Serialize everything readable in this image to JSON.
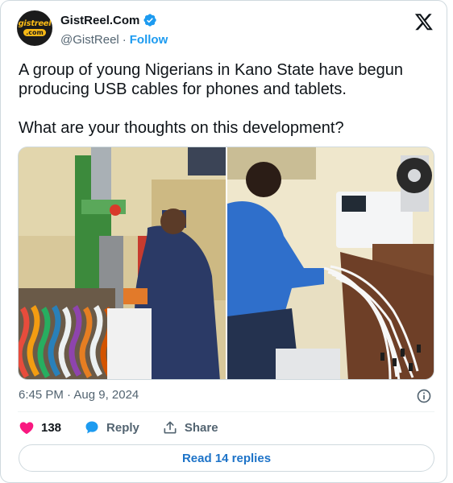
{
  "author": {
    "display_name": "GistReel.Com",
    "handle": "@GistReel",
    "separator": "·",
    "follow_label": "Follow",
    "avatar_text_top": "gistreel",
    "avatar_text_bottom": ".com",
    "verified": true
  },
  "tweet": {
    "text": "A group of young Nigerians in Kano State have begun producing USB cables for phones and tablets.\n\nWhat are your thoughts on this development?",
    "timestamp": "6:45 PM · Aug 9, 2024"
  },
  "media": {
    "photos": [
      {
        "name": "left-photo",
        "subject": "worker at injection molding machine with spools of wire"
      },
      {
        "name": "right-photo",
        "subject": "worker assembling USB cables at table with coiling machine"
      }
    ]
  },
  "actions": {
    "like_count": "138",
    "reply_label": "Reply",
    "share_label": "Share"
  },
  "read_replies_label": "Read 14 replies",
  "colors": {
    "accent": "#1d9bf0",
    "like": "#f91880",
    "text": "#0f1419",
    "muted": "#536471",
    "border": "#cfd9de"
  }
}
